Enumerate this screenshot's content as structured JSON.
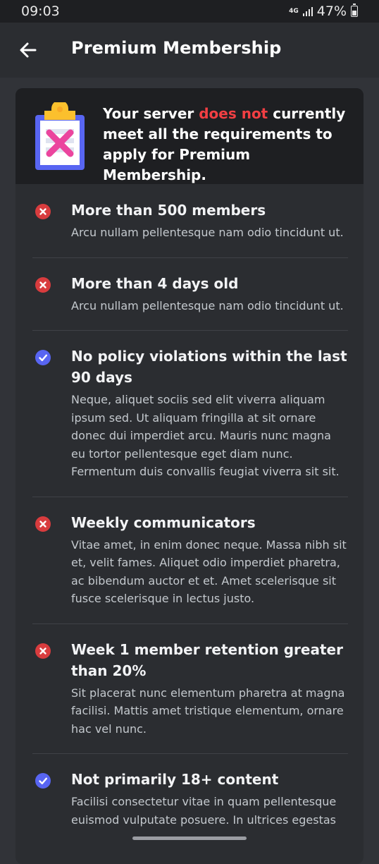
{
  "status_bar": {
    "time": "09:03",
    "network": "4G",
    "battery": "47%",
    "battery_level": 0.47
  },
  "header": {
    "title": "Premium Membership"
  },
  "banner": {
    "text_before": "Your server ",
    "highlight": "does not",
    "text_after": " currently meet all the requirements to apply for Premium Membership."
  },
  "requirements": [
    {
      "status": "fail",
      "title": "More than 500 members",
      "description": "Arcu nullam pellentesque nam odio tincidunt ut."
    },
    {
      "status": "fail",
      "title": "More than 4 days old",
      "description": "Arcu nullam pellentesque nam odio tincidunt ut."
    },
    {
      "status": "pass",
      "title": "No policy violations within the last 90 days",
      "description": "Neque, aliquet sociis sed elit viverra aliquam ipsum sed. Ut aliquam fringilla at sit ornare donec dui imperdiet arcu. Mauris nunc magna eu tortor pellentesque eget diam nunc. Fermentum duis convallis feugiat viverra sit sit."
    },
    {
      "status": "fail",
      "title": "Weekly communicators",
      "description": "Vitae amet, in enim donec neque. Massa nibh sit et, velit fames. Aliquet odio imperdiet pharetra, ac bibendum auctor et et. Amet scelerisque sit fusce scelerisque in lectus justo."
    },
    {
      "status": "fail",
      "title": "Week 1 member retention greater than 20%",
      "description": "Sit placerat nunc elementum pharetra at magna facilisi. Mattis amet tristique elementum, ornare hac vel nunc."
    },
    {
      "status": "pass",
      "title": "Not primarily 18+ content",
      "description": "Facilisi consectetur vitae in quam pellentesque euismod vulputate posuere. In ultrices egestas"
    }
  ],
  "colors": {
    "fail": "#d83c3e",
    "pass": "#5865f2",
    "highlight": "#f23f43",
    "background": "#313338"
  },
  "icons": {
    "back": "arrow-left-icon",
    "fail": "x-circle-icon",
    "pass": "check-circle-icon",
    "banner": "clipboard-x-icon"
  }
}
